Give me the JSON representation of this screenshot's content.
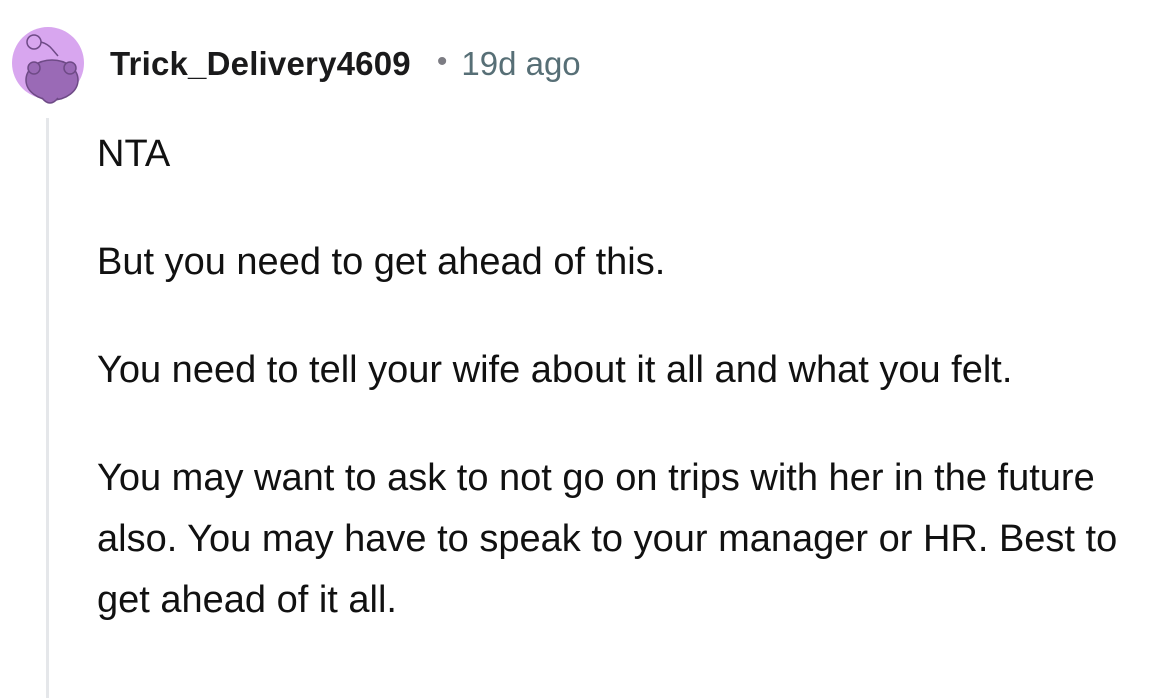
{
  "comment": {
    "author": "Trick_Delivery4609",
    "separator": "•",
    "timestamp": "19d ago",
    "avatar_icon": "reddit-snoo-avatar-icon",
    "avatar_bg": "#d8a6ef",
    "avatar_fg": "#9a6ab6",
    "paragraphs": [
      "NTA",
      "But you need to get ahead of this.",
      "You need to tell your wife about it all and what you felt.",
      "You may want to ask to not go on trips with her in the future also. You may have to speak to your manager or HR. Best to get ahead of it all."
    ]
  }
}
